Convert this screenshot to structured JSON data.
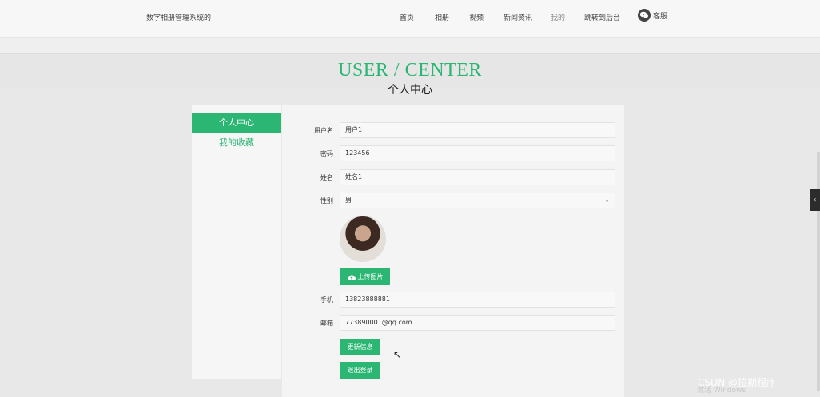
{
  "site": {
    "title": "数字相册管理系统的"
  },
  "nav": {
    "items": [
      {
        "label": "首页"
      },
      {
        "label": "相册"
      },
      {
        "label": "视频"
      },
      {
        "label": "新闻资讯"
      },
      {
        "label": "我的"
      },
      {
        "label": "跳转到后台"
      }
    ],
    "service_label": "客服",
    "service_icon": "wechat-icon"
  },
  "hero": {
    "title_en": "USER / CENTER",
    "title_cn": "个人中心"
  },
  "sidebar": {
    "items": [
      {
        "label": "个人中心",
        "active": true
      },
      {
        "label": "我的收藏",
        "active": false
      }
    ]
  },
  "form": {
    "username": {
      "label": "用户名",
      "value": "用户1"
    },
    "password": {
      "label": "密码",
      "value": "123456"
    },
    "name": {
      "label": "姓名",
      "value": "姓名1"
    },
    "gender": {
      "label": "性别",
      "value": "男"
    },
    "upload_button": "上传图片",
    "upload_icon": "cloud-upload-icon",
    "phone": {
      "label": "手机",
      "value": "13823888881"
    },
    "email": {
      "label": "邮箱",
      "value": "773890001@qq.com"
    },
    "update_button": "更新信息",
    "logout_button": "退出登录"
  },
  "watermark": {
    "text": "CSDN @拉期程序",
    "windows_text": "激活 Windows"
  },
  "colors": {
    "accent": "#2bb673"
  }
}
